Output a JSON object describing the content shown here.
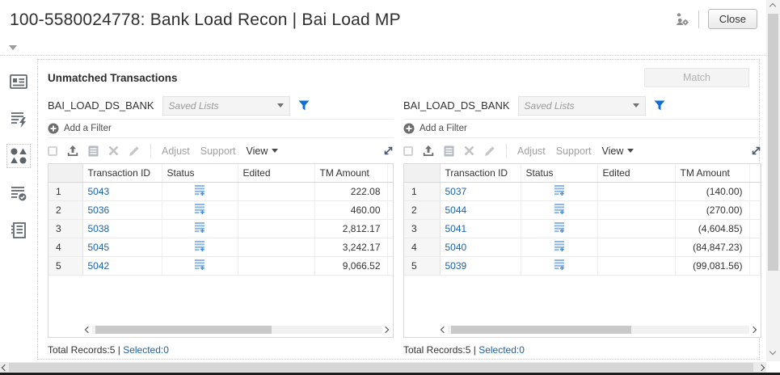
{
  "colors": {
    "accent_blue": "#0b6fd6",
    "link_blue": "#1a62b0",
    "status_icon_blue": "#7fb0e2"
  },
  "window": {
    "title": "100-5580024778: Bank Load Recon | Bai Load MP",
    "close_label": "Close"
  },
  "main": {
    "section_title": "Unmatched Transactions",
    "match_label": "Match"
  },
  "panels": [
    {
      "source_label": "BAI_LOAD_DS_BANK",
      "saved_lists_placeholder": "Saved Lists",
      "add_filter_label": "Add a Filter",
      "toolbar": {
        "adjust_label": "Adjust",
        "support_label": "Support",
        "view_label": "View"
      },
      "table": {
        "columns": [
          "Transaction ID",
          "Status",
          "Edited",
          "TM Amount"
        ],
        "rows": [
          {
            "num": "1",
            "transaction_id": "5043",
            "edited": "",
            "tm_amount": "222.08"
          },
          {
            "num": "2",
            "transaction_id": "5036",
            "edited": "",
            "tm_amount": "460.00"
          },
          {
            "num": "3",
            "transaction_id": "5038",
            "edited": "",
            "tm_amount": "2,812.17"
          },
          {
            "num": "4",
            "transaction_id": "5045",
            "edited": "",
            "tm_amount": "3,242.17"
          },
          {
            "num": "5",
            "transaction_id": "5042",
            "edited": "",
            "tm_amount": "9,066.52"
          }
        ]
      },
      "footer": {
        "total_label": "Total Records:5",
        "divider": "|",
        "selected_label": "Selected:0"
      }
    },
    {
      "source_label": "BAI_LOAD_DS_BANK",
      "saved_lists_placeholder": "Saved Lists",
      "add_filter_label": "Add a Filter",
      "toolbar": {
        "adjust_label": "Adjust",
        "support_label": "Support",
        "view_label": "View"
      },
      "table": {
        "columns": [
          "Transaction ID",
          "Status",
          "Edited",
          "TM Amount"
        ],
        "rows": [
          {
            "num": "1",
            "transaction_id": "5037",
            "edited": "",
            "tm_amount": "(140.00)"
          },
          {
            "num": "2",
            "transaction_id": "5044",
            "edited": "",
            "tm_amount": "(270.00)"
          },
          {
            "num": "3",
            "transaction_id": "5041",
            "edited": "",
            "tm_amount": "(4,604.85)"
          },
          {
            "num": "4",
            "transaction_id": "5040",
            "edited": "",
            "tm_amount": "(84,847.23)"
          },
          {
            "num": "5",
            "transaction_id": "5039",
            "edited": "",
            "tm_amount": "(99,081.56)"
          }
        ]
      },
      "footer": {
        "total_label": "Total Records:5",
        "divider": "|",
        "selected_label": "Selected:0"
      }
    }
  ]
}
